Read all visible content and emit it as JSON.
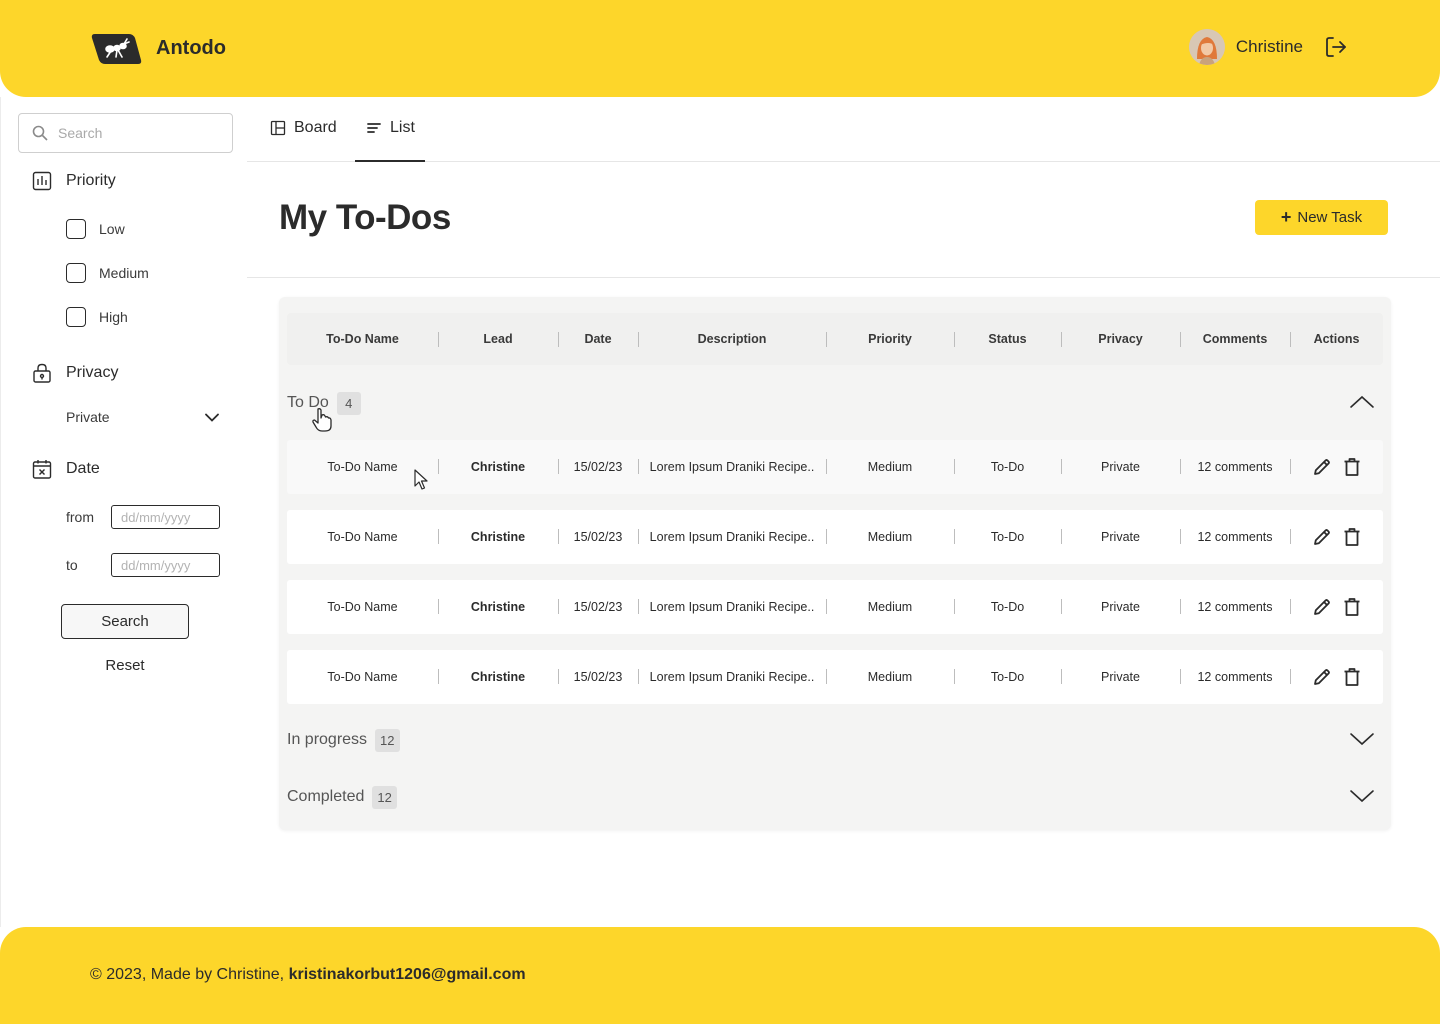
{
  "brand": {
    "name": "Antodo",
    "accent_color": "#FDD62A",
    "logo_icon": "ant-icon"
  },
  "user": {
    "name": "Christine",
    "avatar_icon": "avatar-icon",
    "logout_icon": "logout-icon"
  },
  "sidebar": {
    "search_placeholder": "Search",
    "priority": {
      "label": "Priority",
      "options": [
        "Low",
        "Medium",
        "High"
      ]
    },
    "privacy": {
      "label": "Privacy",
      "selected": "Private"
    },
    "date": {
      "label": "Date",
      "from_label": "from",
      "to_label": "to",
      "placeholder": "dd/mm/yyyy"
    },
    "search_button": "Search",
    "reset_button": "Reset"
  },
  "tabs": [
    {
      "label": "Board",
      "icon": "board-icon",
      "active": false
    },
    {
      "label": "List",
      "icon": "list-icon",
      "active": true
    }
  ],
  "page": {
    "title": "My To-Dos",
    "new_task_label": "New Task"
  },
  "table": {
    "columns": [
      "To-Do Name",
      "Lead",
      "Date",
      "Description",
      "Priority",
      "Status",
      "Privacy",
      "Comments",
      "Actions"
    ],
    "groups": [
      {
        "label": "To Do",
        "count": "4",
        "expanded": true,
        "rows": [
          {
            "name": "To-Do Name",
            "lead": "Christine",
            "date": "15/02/23",
            "description": "Lorem Ipsum Draniki Recipe..",
            "priority": "Medium",
            "status": "To-Do",
            "privacy": "Private",
            "comments": "12 comments"
          },
          {
            "name": "To-Do Name",
            "lead": "Christine",
            "date": "15/02/23",
            "description": "Lorem Ipsum Draniki Recipe..",
            "priority": "Medium",
            "status": "To-Do",
            "privacy": "Private",
            "comments": "12 comments"
          },
          {
            "name": "To-Do Name",
            "lead": "Christine",
            "date": "15/02/23",
            "description": "Lorem Ipsum Draniki Recipe..",
            "priority": "Medium",
            "status": "To-Do",
            "privacy": "Private",
            "comments": "12 comments"
          },
          {
            "name": "To-Do Name",
            "lead": "Christine",
            "date": "15/02/23",
            "description": "Lorem Ipsum Draniki Recipe..",
            "priority": "Medium",
            "status": "To-Do",
            "privacy": "Private",
            "comments": "12 comments"
          }
        ]
      },
      {
        "label": "In progress",
        "count": "12",
        "expanded": false
      },
      {
        "label": "Completed",
        "count": "12",
        "expanded": false
      }
    ]
  },
  "footer": {
    "text": "© 2023, Made by Christine,",
    "email": "kristinakorbut1206@gmail.com"
  }
}
